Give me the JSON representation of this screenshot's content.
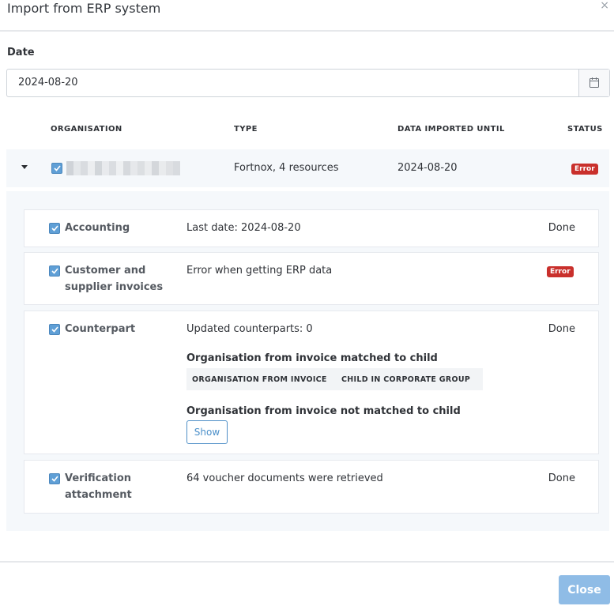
{
  "modal": {
    "title": "Import from ERP system",
    "close_glyph": "×"
  },
  "date": {
    "label": "Date",
    "value": "2024-08-20",
    "calendar_icon": "calendar-icon"
  },
  "table": {
    "headers": {
      "organisation": "ORGANISATION",
      "type": "TYPE",
      "imported_until": "DATA IMPORTED UNTIL",
      "status": "STATUS"
    },
    "row": {
      "type": "Fortnox, 4 resources",
      "imported_until": "2024-08-20",
      "status": "Error",
      "organisation_redacted": true
    }
  },
  "resources": [
    {
      "name": "Accounting",
      "info": "Last date: 2024-08-20",
      "status": "Done"
    },
    {
      "name_line1": "Customer and",
      "name_line2": "supplier invoices",
      "info": "Error when getting ERP data",
      "status": "Error"
    },
    {
      "name": "Counterpart",
      "info": "Updated counterparts: 0",
      "status": "Done",
      "matched_heading": "Organisation from invoice matched to child",
      "matched_columns": [
        "ORGANISATION FROM INVOICE",
        "CHILD IN CORPORATE GROUP"
      ],
      "unmatched_heading": "Organisation from invoice not matched to child",
      "show_label": "Show"
    },
    {
      "name_line1": "Verification",
      "name_line2": "attachment",
      "info": "64 voucher documents were retrieved",
      "status": "Done"
    }
  ],
  "footer": {
    "close_label": "Close"
  },
  "colors": {
    "accent": "#4a8fc9",
    "error": "#c9302c",
    "checkbox": "#5f9fd6",
    "panel_bg": "#f5f8fb",
    "close_button": "#8fbce6"
  }
}
